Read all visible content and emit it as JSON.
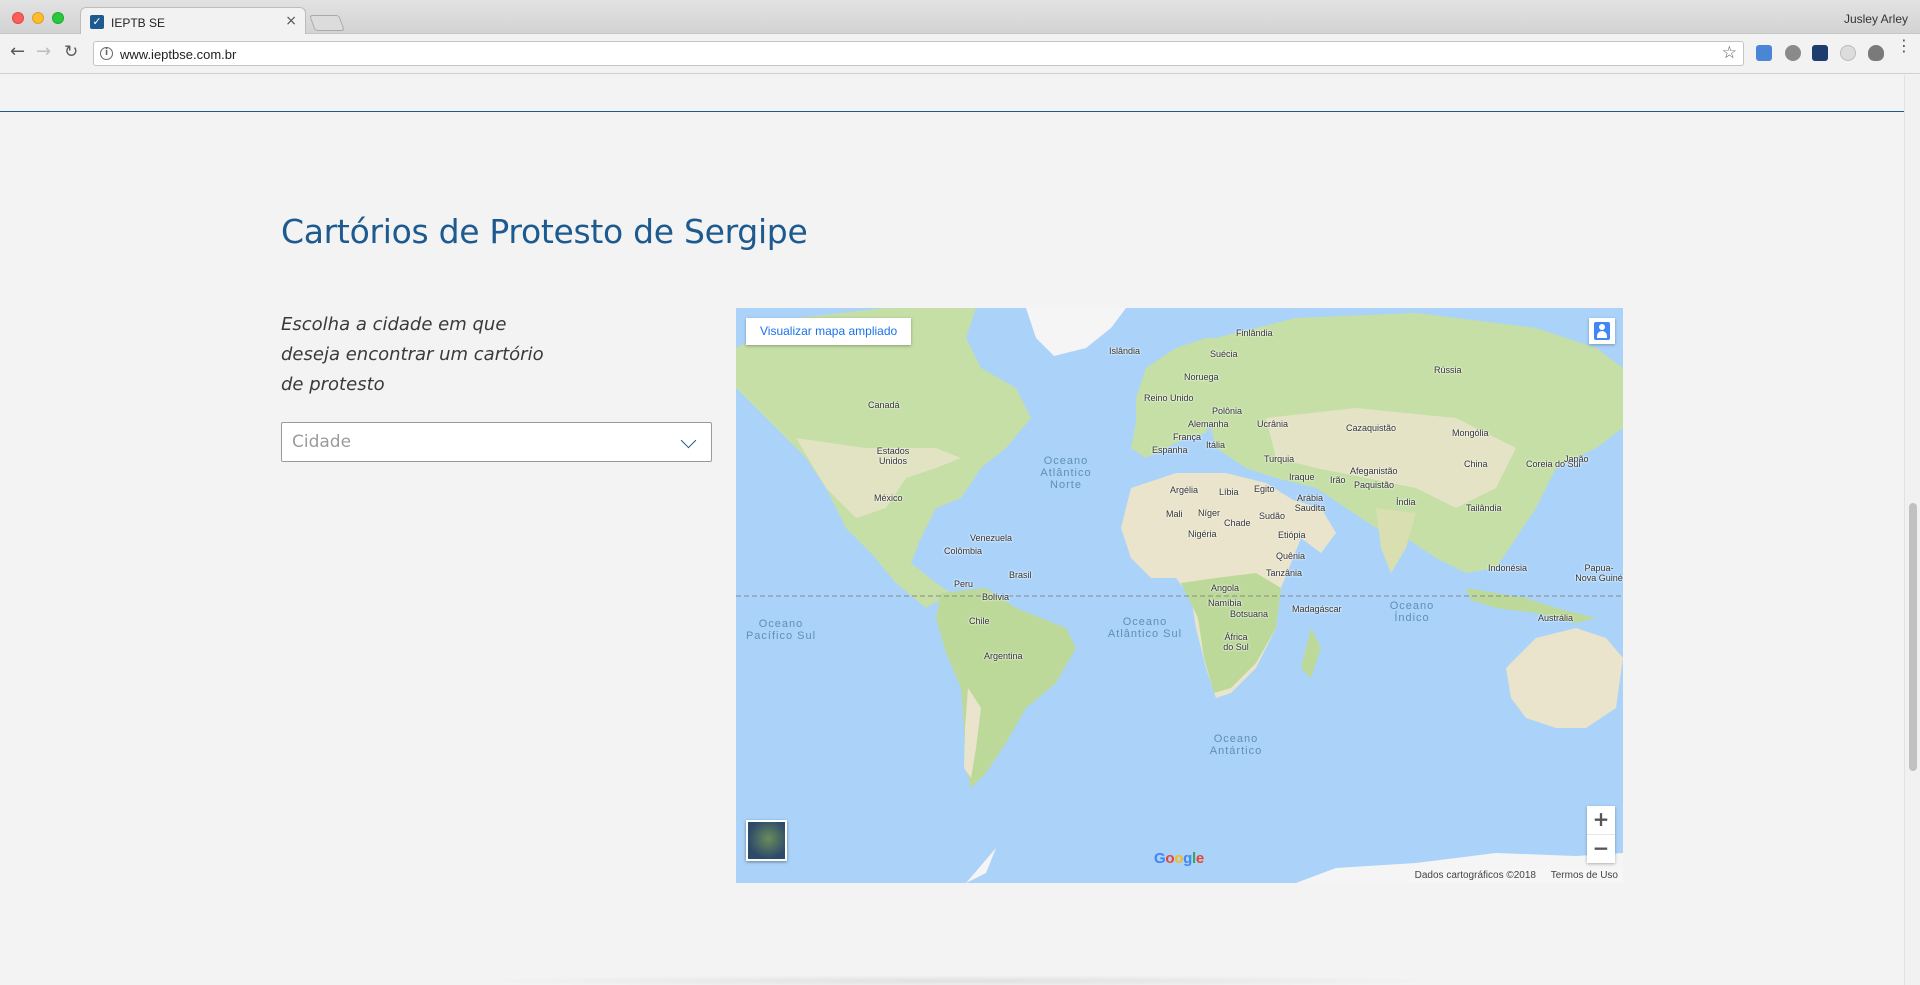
{
  "browser": {
    "tab_title": "IEPTB SE",
    "tab_close": "×",
    "profile_name": "Jusley Arley",
    "url": "www.ieptbse.com.br",
    "back_icon": "←",
    "forward_icon": "→",
    "reload_icon": "↻",
    "star_icon": "☆",
    "info_icon": "i",
    "menu_icon": "⋮",
    "favicon_glyph": "✓",
    "extensions": [
      "google-translate-icon",
      "globe-icon",
      "react-devtools-icon",
      "disabled-extension-icon",
      "bug-icon"
    ]
  },
  "page": {
    "heading": "Cartórios de Protesto de Sergipe",
    "intro_text": "Escolha a cidade em que deseja encontrar um cartório de protesto",
    "city_select": {
      "selected_value": "Cidade"
    }
  },
  "map": {
    "view_larger_link": "Visualizar mapa ampliado",
    "zoom_in": "+",
    "zoom_out": "−",
    "attribution_data": "Dados cartográficos ©2018",
    "attribution_terms": "Termos de Uso",
    "logo_letters": [
      "G",
      "o",
      "o",
      "g",
      "l",
      "e"
    ],
    "country_labels": [
      "Islândia",
      "Finlândia",
      "Suécia",
      "Noruega",
      "Rússia",
      "Reino Unido",
      "Polônia",
      "Alemanha",
      "Ucrânia",
      "Cazaquistão",
      "Mongólia",
      "França",
      "Itália",
      "Espanha",
      "Turquia",
      "China",
      "Coreia do Sul",
      "Japão",
      "Canadá",
      "Estados Unidos",
      "Argélia",
      "Líbia",
      "Egito",
      "Iraque",
      "Irão",
      "Afeganistão",
      "Paquistão",
      "Arábia Saudita",
      "Índia",
      "Tailândia",
      "México",
      "Mali",
      "Níger",
      "Chade",
      "Sudão",
      "Nigéria",
      "Etiópia",
      "Venezuela",
      "Colômbia",
      "Quênia",
      "Tanzânia",
      "Indonésia",
      "Papua-Nova Guiné",
      "Brasil",
      "Peru",
      "Bolívia",
      "Angola",
      "Namíbia",
      "Botsuana",
      "Madagáscar",
      "Austrália",
      "Chile",
      "África do Sul",
      "Argentina"
    ],
    "ocean_labels": [
      "Oceano Atlântico Norte",
      "Oceano Pacífico Sul",
      "Oceano Atlântico Sul",
      "Oceano Índico",
      "Oceano Antártico"
    ]
  }
}
